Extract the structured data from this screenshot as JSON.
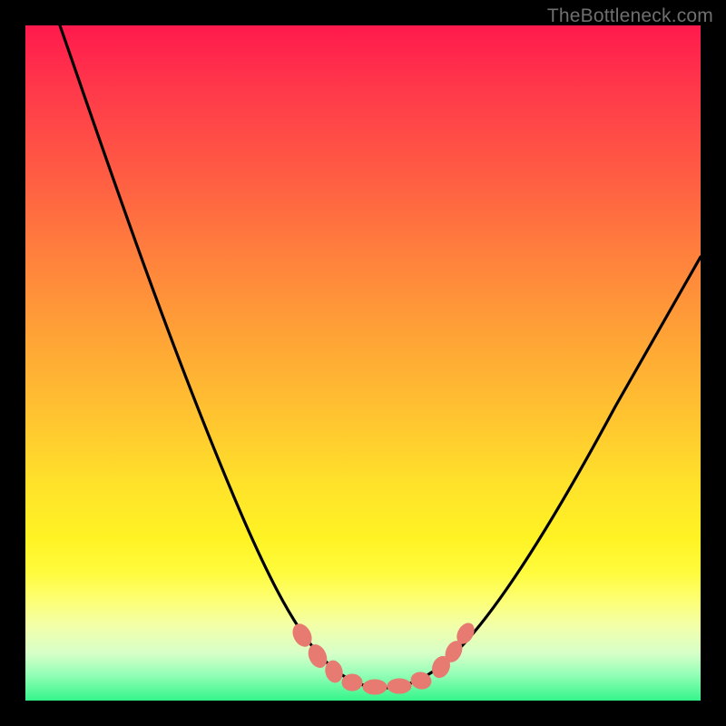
{
  "watermark": "TheBottleneck.com",
  "chart_data": {
    "type": "line",
    "title": "",
    "xlabel": "",
    "ylabel": "",
    "xlim": [
      0,
      100
    ],
    "ylim": [
      0,
      100
    ],
    "background_gradient": {
      "top": "#ff1a4d",
      "middle": "#ffe22a",
      "bottom": "#35f58a"
    },
    "series": [
      {
        "name": "bottleneck-curve",
        "color": "#000000",
        "x": [
          5,
          10,
          15,
          20,
          25,
          30,
          35,
          38,
          40,
          42,
          44,
          46,
          48,
          50,
          52,
          55,
          58,
          62,
          68,
          75,
          82,
          90,
          100
        ],
        "y": [
          100,
          85,
          72,
          60,
          48,
          37,
          27,
          20,
          15,
          11,
          8,
          6,
          5,
          4.5,
          4.5,
          5,
          6,
          9,
          14,
          22,
          32,
          44,
          60
        ]
      }
    ],
    "markers": {
      "name": "bottom-dots",
      "color": "#e77a71",
      "points": [
        {
          "x": 40,
          "y": 12
        },
        {
          "x": 42,
          "y": 9
        },
        {
          "x": 44,
          "y": 7
        },
        {
          "x": 46,
          "y": 5.5
        },
        {
          "x": 48,
          "y": 5
        },
        {
          "x": 50,
          "y": 4.8
        },
        {
          "x": 52,
          "y": 5
        },
        {
          "x": 55,
          "y": 6
        },
        {
          "x": 57,
          "y": 8
        },
        {
          "x": 59,
          "y": 11
        }
      ]
    }
  }
}
